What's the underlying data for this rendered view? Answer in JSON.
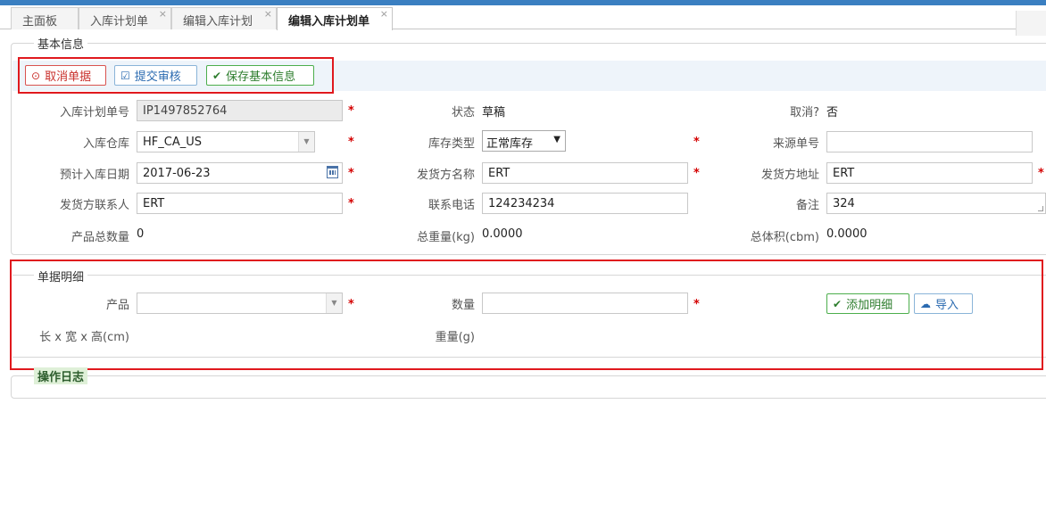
{
  "tabs": [
    {
      "label": "主面板",
      "closable": false
    },
    {
      "label": "入库计划单",
      "closable": true
    },
    {
      "label": "编辑入库计划",
      "closable": true
    },
    {
      "label": "编辑入库计划单",
      "closable": true,
      "active": true
    }
  ],
  "close_glyph": "×",
  "basic_info": {
    "legend": "基本信息",
    "toolbar": {
      "cancel_label": "取消单据",
      "submit_label": "提交审核",
      "save_label": "保存基本信息"
    },
    "fields": {
      "plan_no_label": "入库计划单号",
      "plan_no_value": "IP1497852764",
      "status_label": "状态",
      "status_value": "草稿",
      "cancelled_label": "取消?",
      "cancelled_value": "否",
      "warehouse_label": "入库仓库",
      "warehouse_value": "HF_CA_US",
      "stock_type_label": "库存类型",
      "stock_type_value": "正常库存",
      "source_no_label": "来源单号",
      "source_no_value": "",
      "eta_label": "预计入库日期",
      "eta_value": "2017-06-23",
      "shipper_name_label": "发货方名称",
      "shipper_name_value": "ERT",
      "shipper_addr_label": "发货方地址",
      "shipper_addr_value": "ERT",
      "shipper_contact_label": "发货方联系人",
      "shipper_contact_value": "ERT",
      "phone_label": "联系电话",
      "phone_value": "124234234",
      "remark_label": "备注",
      "remark_value": "324",
      "total_qty_label": "产品总数量",
      "total_qty_value": "0",
      "total_weight_label": "总重量(kg)",
      "total_weight_value": "0.0000",
      "total_volume_label": "总体积(cbm)",
      "total_volume_value": "0.0000"
    }
  },
  "detail": {
    "legend": "单据明细",
    "product_label": "产品",
    "product_value": "",
    "quantity_label": "数量",
    "quantity_value": "",
    "dimensions_label": "长 x 宽 x 高(cm)",
    "weight_label": "重量(g)",
    "add_label": "添加明细",
    "import_label": "导入"
  },
  "log": {
    "legend": "操作日志"
  },
  "required_mark": "*",
  "colors": {
    "accent": "#3a7fc1",
    "required": "#d40000",
    "highlight_box": "#e0191e",
    "toolbar_bg": "#eef4fa"
  }
}
